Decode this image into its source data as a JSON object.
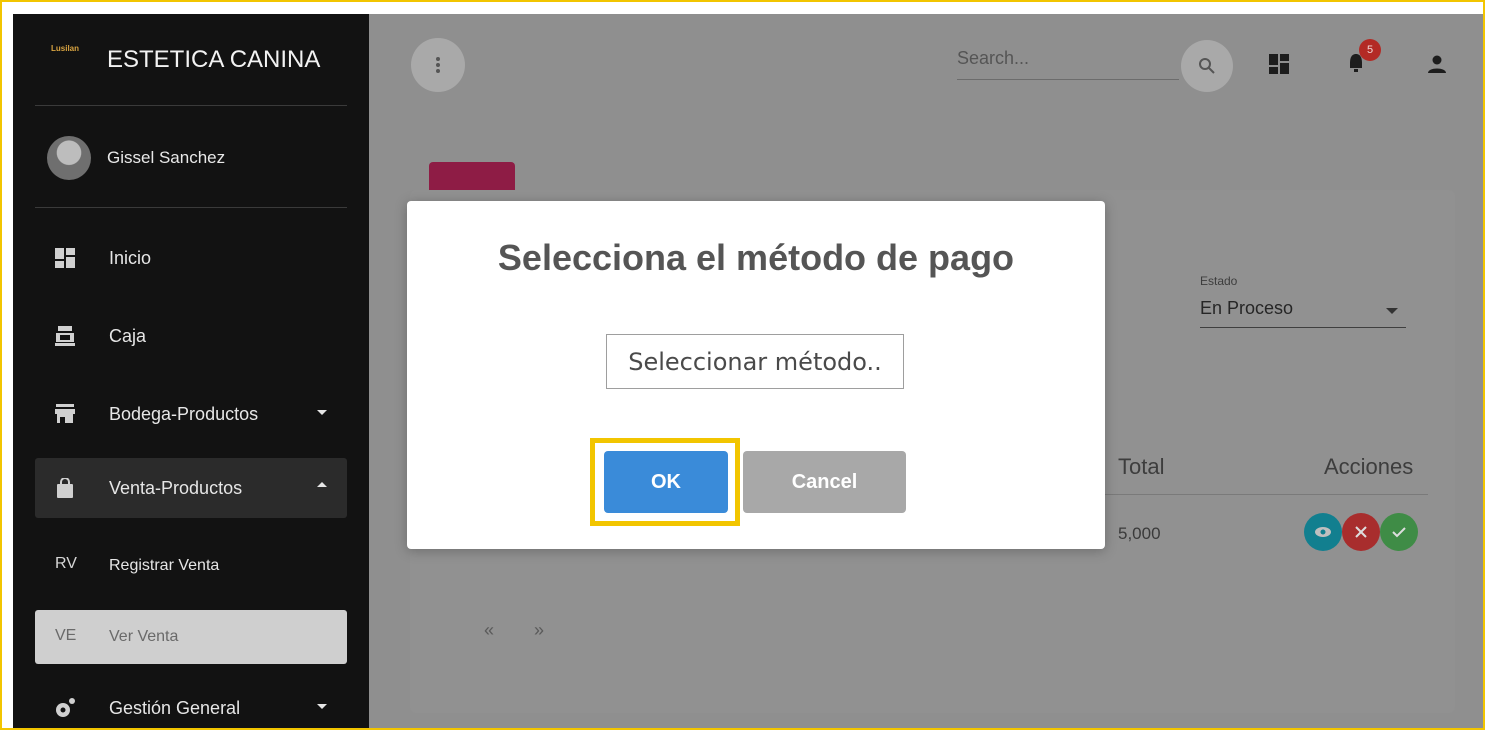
{
  "sidebar": {
    "brand_logo": "Lusilan",
    "brand_title": "ESTETICA CANINA",
    "user_name": "Gissel Sanchez",
    "items": [
      {
        "label": "Inicio",
        "icon": "dashboard-icon"
      },
      {
        "label": "Caja",
        "icon": "cash-register-icon"
      },
      {
        "label": "Bodega-Productos",
        "icon": "store-icon"
      },
      {
        "label": "Venta-Productos",
        "icon": "shopping-bag-icon"
      },
      {
        "abbr": "RV",
        "label": "Registrar Venta"
      },
      {
        "abbr": "VE",
        "label": "Ver Venta"
      },
      {
        "label": "Gestión General",
        "icon": "settings-icon"
      }
    ]
  },
  "header": {
    "search_placeholder": "Search...",
    "notification_count": "5"
  },
  "card": {
    "estado_label": "Estado",
    "estado_value": "En Proceso",
    "columns": {
      "total": "Total",
      "acciones": "Acciones"
    },
    "rows": [
      {
        "total": "5,000"
      }
    ],
    "pager": {
      "prev": "«",
      "next": "»"
    }
  },
  "modal": {
    "title": "Selecciona el método de pago",
    "select_placeholder": "Seleccionar método..",
    "ok_label": "OK",
    "cancel_label": "Cancel"
  },
  "colors": {
    "sidebar_bg": "#121212",
    "ok_button": "#3a8bd9",
    "cancel_button": "#a8a8a8",
    "highlight": "#f2c500",
    "card_tab": "#8e1c45"
  }
}
